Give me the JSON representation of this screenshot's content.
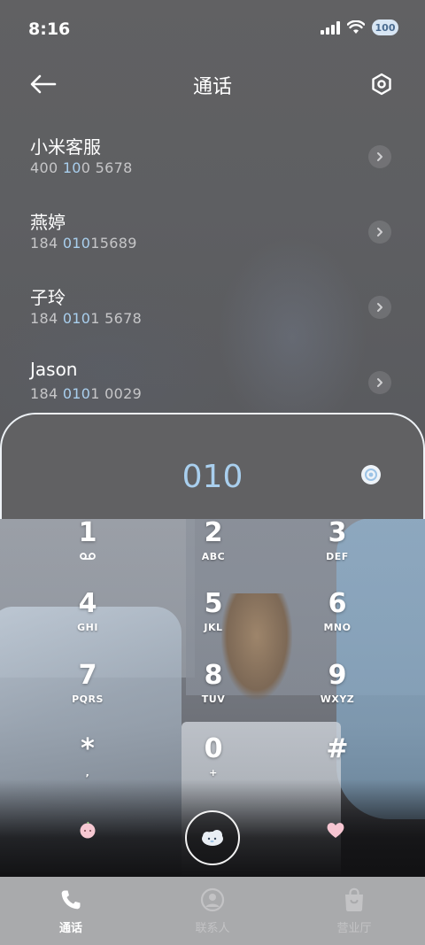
{
  "status_bar": {
    "time": "8:16",
    "battery": "100"
  },
  "header": {
    "title": "通话"
  },
  "contacts": [
    {
      "name": "小米客服",
      "number_parts": [
        {
          "t": "400 ",
          "h": false
        },
        {
          "t": "10",
          "h": true
        },
        {
          "t": "0 5678",
          "h": false
        }
      ]
    },
    {
      "name": "燕婷",
      "number_parts": [
        {
          "t": "184 ",
          "h": false
        },
        {
          "t": "010",
          "h": true
        },
        {
          "t": "15689",
          "h": false
        }
      ]
    },
    {
      "name": "子玲",
      "number_parts": [
        {
          "t": "184 ",
          "h": false
        },
        {
          "t": "010",
          "h": true
        },
        {
          "t": "1 5678",
          "h": false
        }
      ]
    },
    {
      "name": "Jason",
      "number_parts": [
        {
          "t": "184 ",
          "h": false
        },
        {
          "t": "010",
          "h": true
        },
        {
          "t": "1 0029",
          "h": false
        }
      ]
    }
  ],
  "dialer": {
    "input": "010"
  },
  "keypad": [
    {
      "digit": "1",
      "letters": "voicemail-icon"
    },
    {
      "digit": "2",
      "letters": "ABC"
    },
    {
      "digit": "3",
      "letters": "DEF"
    },
    {
      "digit": "4",
      "letters": "GHI"
    },
    {
      "digit": "5",
      "letters": "JKL"
    },
    {
      "digit": "6",
      "letters": "MNO"
    },
    {
      "digit": "7",
      "letters": "PQRS"
    },
    {
      "digit": "8",
      "letters": "TUV"
    },
    {
      "digit": "9",
      "letters": "WXYZ"
    },
    {
      "digit": "*",
      "letters": ","
    },
    {
      "digit": "0",
      "letters": "+"
    },
    {
      "digit": "#",
      "letters": ""
    }
  ],
  "bottom_nav": {
    "items": [
      {
        "label": "通话",
        "icon": "phone-icon",
        "active": true
      },
      {
        "label": "联系人",
        "icon": "contacts-icon",
        "active": false
      },
      {
        "label": "营业厅",
        "icon": "store-icon",
        "active": false
      }
    ]
  },
  "colors": {
    "accent": "#a9cfee",
    "nav_background": "#a9aaac"
  }
}
